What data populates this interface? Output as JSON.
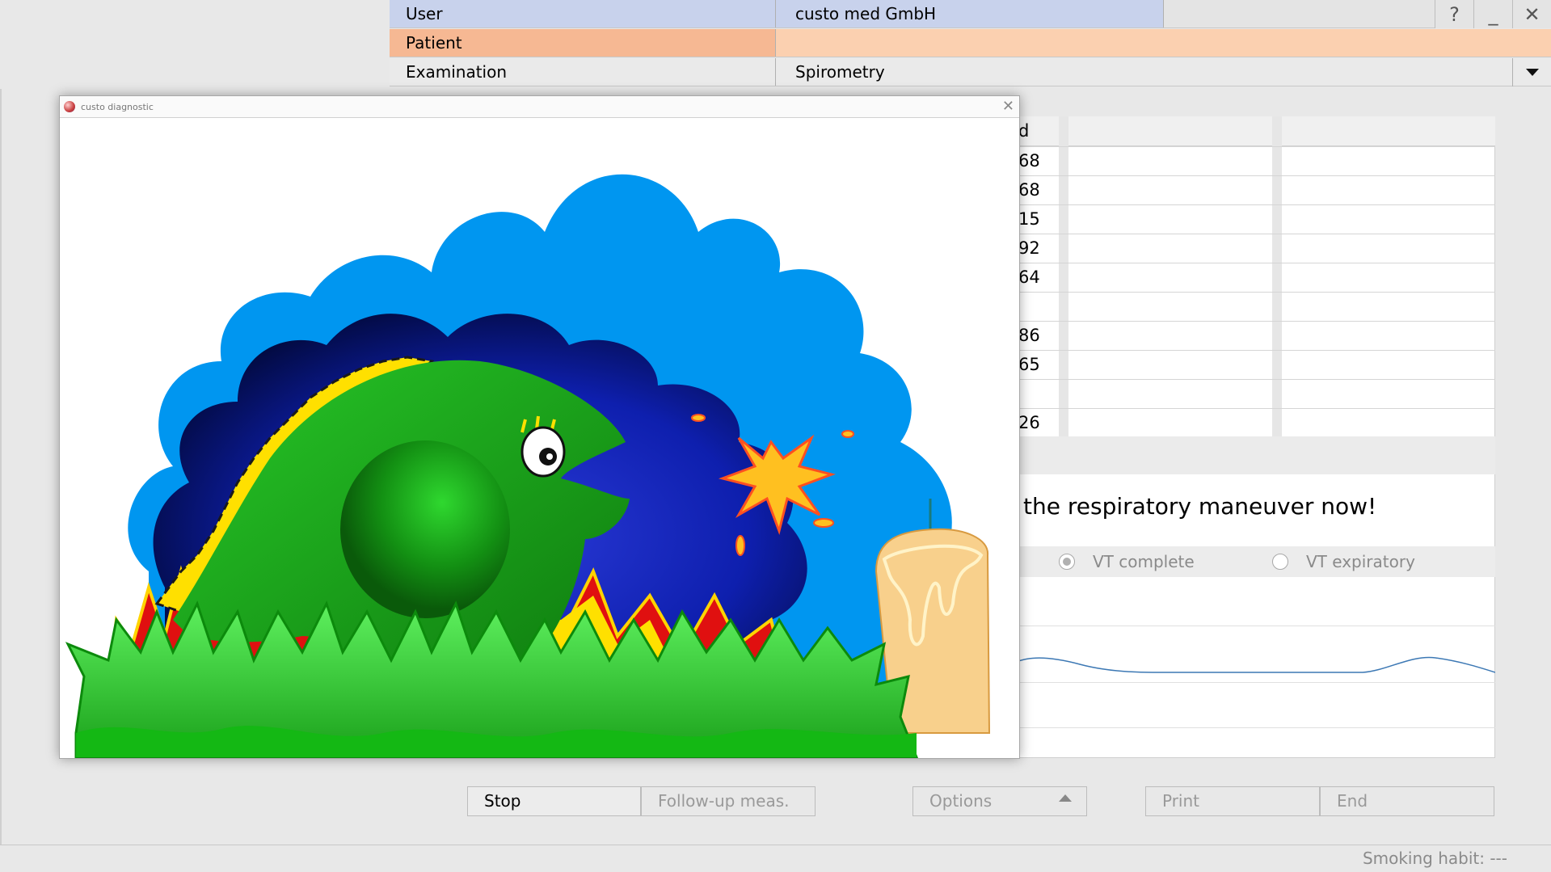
{
  "header": {
    "user_label": "User",
    "user_value": "custo med GmbH",
    "patient_label": "Patient",
    "patient_value": "",
    "exam_label": "Examination",
    "exam_value": "Spirometry",
    "help_glyph": "?",
    "minimize_glyph": "_",
    "close_glyph": "✕"
  },
  "table": {
    "head_fragment": "d",
    "rows": [
      "68",
      "68",
      "15",
      "92",
      "64",
      "",
      "86",
      "65",
      "",
      "26"
    ]
  },
  "instruction": "the respiratory maneuver now!",
  "radios": {
    "vt_complete": "VT complete",
    "vt_expiratory": "VT expiratory",
    "selected": "VT complete"
  },
  "buttons": {
    "stop": "Stop",
    "follow_up": "Follow-up meas.",
    "options": "Options",
    "print": "Print",
    "end": "End"
  },
  "status": {
    "smoking": "Smoking habit: ---"
  },
  "popup": {
    "title": "custo diagnostic",
    "close_glyph": "✕"
  },
  "colors": {
    "user_row": "#c8d2ec",
    "patient_row": "#f9c4a3",
    "sky": "#0096f0",
    "night": "#0a1a9a",
    "fish": "#1fa51f",
    "grass": "#2fcf2f",
    "fire": "#e01010",
    "candle": "#f8d08c"
  }
}
